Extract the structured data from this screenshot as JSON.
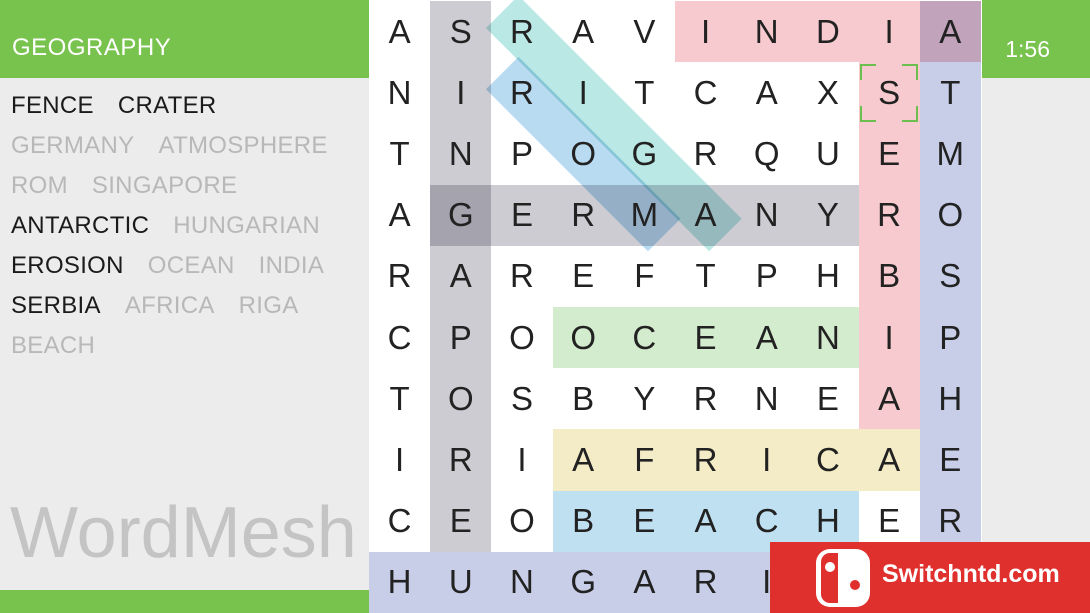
{
  "header": {
    "category": "GEOGRAPHY",
    "timer": "1:56"
  },
  "app": {
    "title": "WordMesh"
  },
  "word_list": [
    {
      "word": "FENCE",
      "found": false
    },
    {
      "word": "CRATER",
      "found": false
    },
    {
      "word": "GERMANY",
      "found": true
    },
    {
      "word": "ATMOSPHERE",
      "found": true
    },
    {
      "word": "ROM",
      "found": true
    },
    {
      "word": "SINGAPORE",
      "found": true
    },
    {
      "word": "ANTARCTIC",
      "found": false
    },
    {
      "word": "HUNGARIAN",
      "found": true
    },
    {
      "word": "EROSION",
      "found": false
    },
    {
      "word": "OCEAN",
      "found": true
    },
    {
      "word": "INDIA",
      "found": true
    },
    {
      "word": "SERBIA",
      "found": false
    },
    {
      "word": "AFRICA",
      "found": true
    },
    {
      "word": "RIGA",
      "found": true
    },
    {
      "word": "BEACH",
      "found": true
    }
  ],
  "grid": [
    [
      "A",
      "S",
      "R",
      "A",
      "V",
      "I",
      "N",
      "D",
      "I",
      "A"
    ],
    [
      "N",
      "I",
      "R",
      "I",
      "T",
      "C",
      "A",
      "X",
      "S",
      "T"
    ],
    [
      "T",
      "N",
      "P",
      "O",
      "G",
      "R",
      "Q",
      "U",
      "E",
      "M"
    ],
    [
      "A",
      "G",
      "E",
      "R",
      "M",
      "A",
      "N",
      "Y",
      "R",
      "O"
    ],
    [
      "R",
      "A",
      "R",
      "E",
      "F",
      "T",
      "P",
      "H",
      "B",
      "S"
    ],
    [
      "C",
      "P",
      "O",
      "O",
      "C",
      "E",
      "A",
      "N",
      "I",
      "P"
    ],
    [
      "T",
      "O",
      "S",
      "B",
      "Y",
      "R",
      "N",
      "E",
      "A",
      "H"
    ],
    [
      "I",
      "R",
      "I",
      "A",
      "F",
      "R",
      "I",
      "C",
      "A",
      "E"
    ],
    [
      "C",
      "E",
      "O",
      "B",
      "E",
      "A",
      "C",
      "H",
      "E",
      "R"
    ],
    [
      "H",
      "U",
      "N",
      "G",
      "A",
      "R",
      "I",
      "",
      "",
      ""
    ]
  ],
  "highlights": [
    {
      "word": "SINGAPORE",
      "start": [
        0,
        1
      ],
      "end": [
        8,
        1
      ],
      "color": "#cdccd3"
    },
    {
      "word": "ATMOSPHERE",
      "start": [
        0,
        9
      ],
      "end": [
        9,
        9
      ],
      "color": "#c8cee8"
    },
    {
      "word": "HUNGARIAN",
      "start": [
        9,
        0
      ],
      "end": [
        9,
        8
      ],
      "color": "#c8cee8"
    },
    {
      "word": "INDIA",
      "start": [
        0,
        5
      ],
      "end": [
        0,
        9
      ],
      "color": "#f6cacf"
    },
    {
      "word": "SERBIA",
      "start": [
        1,
        8
      ],
      "end": [
        6,
        8
      ],
      "color": "#f6cacf"
    },
    {
      "word": "GERMANY",
      "start": [
        3,
        1
      ],
      "end": [
        3,
        7
      ],
      "color": "#cdccd3"
    },
    {
      "word": "OCEAN",
      "start": [
        5,
        3
      ],
      "end": [
        5,
        7
      ],
      "color": "#d4ecce"
    },
    {
      "word": "AFRICA",
      "start": [
        7,
        3
      ],
      "end": [
        7,
        8
      ],
      "color": "#f4ecc6"
    },
    {
      "word": "BEACH",
      "start": [
        8,
        3
      ],
      "end": [
        8,
        7
      ],
      "color": "#bfe0f1"
    },
    {
      "word": "RIGA",
      "start": [
        0,
        2
      ],
      "end": [
        3,
        5
      ],
      "color": "#a9e2de"
    },
    {
      "word": "ROM",
      "start": [
        1,
        2
      ],
      "end": [
        3,
        4
      ],
      "color": "#a8d2ee"
    }
  ],
  "selection": {
    "cell": [
      1,
      8
    ],
    "color": "#6cbf4f"
  },
  "watermark": {
    "text": "Switchntd.com",
    "color": "#e0302d",
    "icon": "nintendo-switch-icon"
  }
}
